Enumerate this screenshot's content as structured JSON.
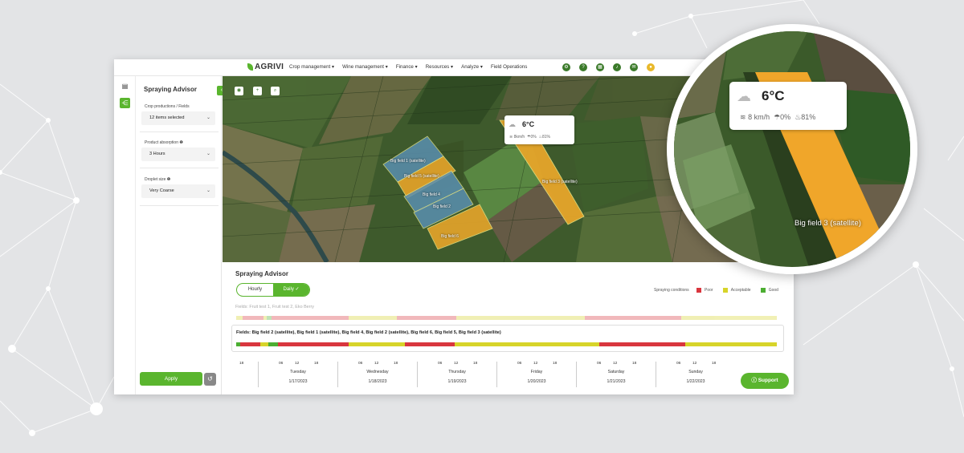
{
  "brand": {
    "name": "AGRIVI"
  },
  "nav": {
    "items": [
      "Crop management ▾",
      "Wine management ▾",
      "Finance ▾",
      "Resources ▾",
      "Analyze ▾",
      "Field Operations"
    ]
  },
  "panel": {
    "title": "Spraying Advisor",
    "crop_label": "Crop productions / Fields",
    "crop_value": "12 items selected",
    "absorption_label": "Product absorption ❶",
    "absorption_value": "3 Hours",
    "droplet_label": "Droplet size ❶",
    "droplet_value": "Very Coarse",
    "apply_label": "Apply"
  },
  "map": {
    "field_labels": [
      "Big field 1 (satellite)",
      "Big field 5 (satellite)",
      "Big field 4",
      "Big field 2",
      "Big field 6",
      "Big field 3 (satellite)"
    ],
    "weather": {
      "temp": "6°C",
      "wind": "8km/h",
      "rain": "0%",
      "humidity": "81%"
    }
  },
  "advisor": {
    "title": "Spraying Advisor",
    "toggle_hourly": "Hourly",
    "toggle_daily": "Daily ✓",
    "legend_title": "Spraying conditions",
    "legend": [
      {
        "label": "Poor",
        "color": "#d9363e"
      },
      {
        "label": "Acceptable",
        "color": "#d7d42a"
      },
      {
        "label": "Good",
        "color": "#4cae32"
      }
    ],
    "fields_row1": "Fields: Fruit test 1, Fruit test 2, Eko Berry",
    "fields_row2": "Fields: Big field 2 (satellite), Big field 1 (satellite), Big field 4, Big field 2 (satellite), Big field 6, Big field 5, Big field 3 (satellite)",
    "first_hour": "18",
    "days": [
      {
        "name": "Tuesday",
        "date": "1/17/2023",
        "h1": "06",
        "h2": "12",
        "h3": "18"
      },
      {
        "name": "Wednesday",
        "date": "1/18/2023",
        "h1": "06",
        "h2": "12",
        "h3": "18"
      },
      {
        "name": "Thursday",
        "date": "1/19/2023",
        "h1": "06",
        "h2": "12",
        "h3": "18"
      },
      {
        "name": "Friday",
        "date": "1/20/2023",
        "h1": "06",
        "h2": "12",
        "h3": "18"
      },
      {
        "name": "Saturday",
        "date": "1/21/2023",
        "h1": "06",
        "h2": "12",
        "h3": "18"
      },
      {
        "name": "Sunday",
        "date": "1/22/2023",
        "h1": "06",
        "h2": "12",
        "h3": "18"
      }
    ],
    "support_label": "Support"
  },
  "zoom": {
    "temp": "6°C",
    "wind": "8 km/h",
    "rain": "0%",
    "humidity": "81%",
    "field_label": "Big field 3 (satellite)"
  }
}
